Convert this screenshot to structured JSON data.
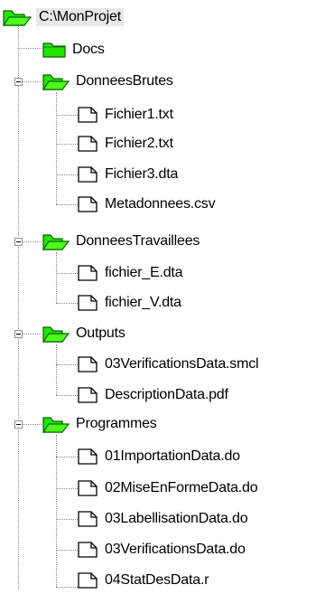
{
  "tree": {
    "root": {
      "label": "C:\\MonProjet",
      "icon": "open-folder-icon"
    },
    "folders": [
      {
        "label": "Docs",
        "icon": "closed-folder-icon",
        "files": []
      },
      {
        "label": "DonneesBrutes",
        "icon": "open-folder-icon",
        "files": [
          {
            "label": "Fichier1.txt"
          },
          {
            "label": "Fichier2.txt"
          },
          {
            "label": "Fichier3.dta"
          },
          {
            "label": "Metadonnees.csv"
          }
        ]
      },
      {
        "label": "DonneesTravaillees",
        "icon": "open-folder-icon",
        "files": [
          {
            "label": "fichier_E.dta"
          },
          {
            "label": "fichier_V.dta"
          }
        ]
      },
      {
        "label": "Outputs",
        "icon": "open-folder-icon",
        "files": [
          {
            "label": "03VerificationsData.smcl"
          },
          {
            "label": "DescriptionData.pdf"
          }
        ]
      },
      {
        "label": "Programmes",
        "icon": "open-folder-icon",
        "files": [
          {
            "label": "01ImportationData.do"
          },
          {
            "label": "02MiseEnFormeData.do"
          },
          {
            "label": "03LabellisationData.do"
          },
          {
            "label": "03VerificationsData.do"
          },
          {
            "label": "04StatDesData.r"
          }
        ]
      }
    ],
    "colors": {
      "folder": "#21e600",
      "folder_outline": "#0f5f00",
      "connector": "#8a8a8a"
    }
  }
}
